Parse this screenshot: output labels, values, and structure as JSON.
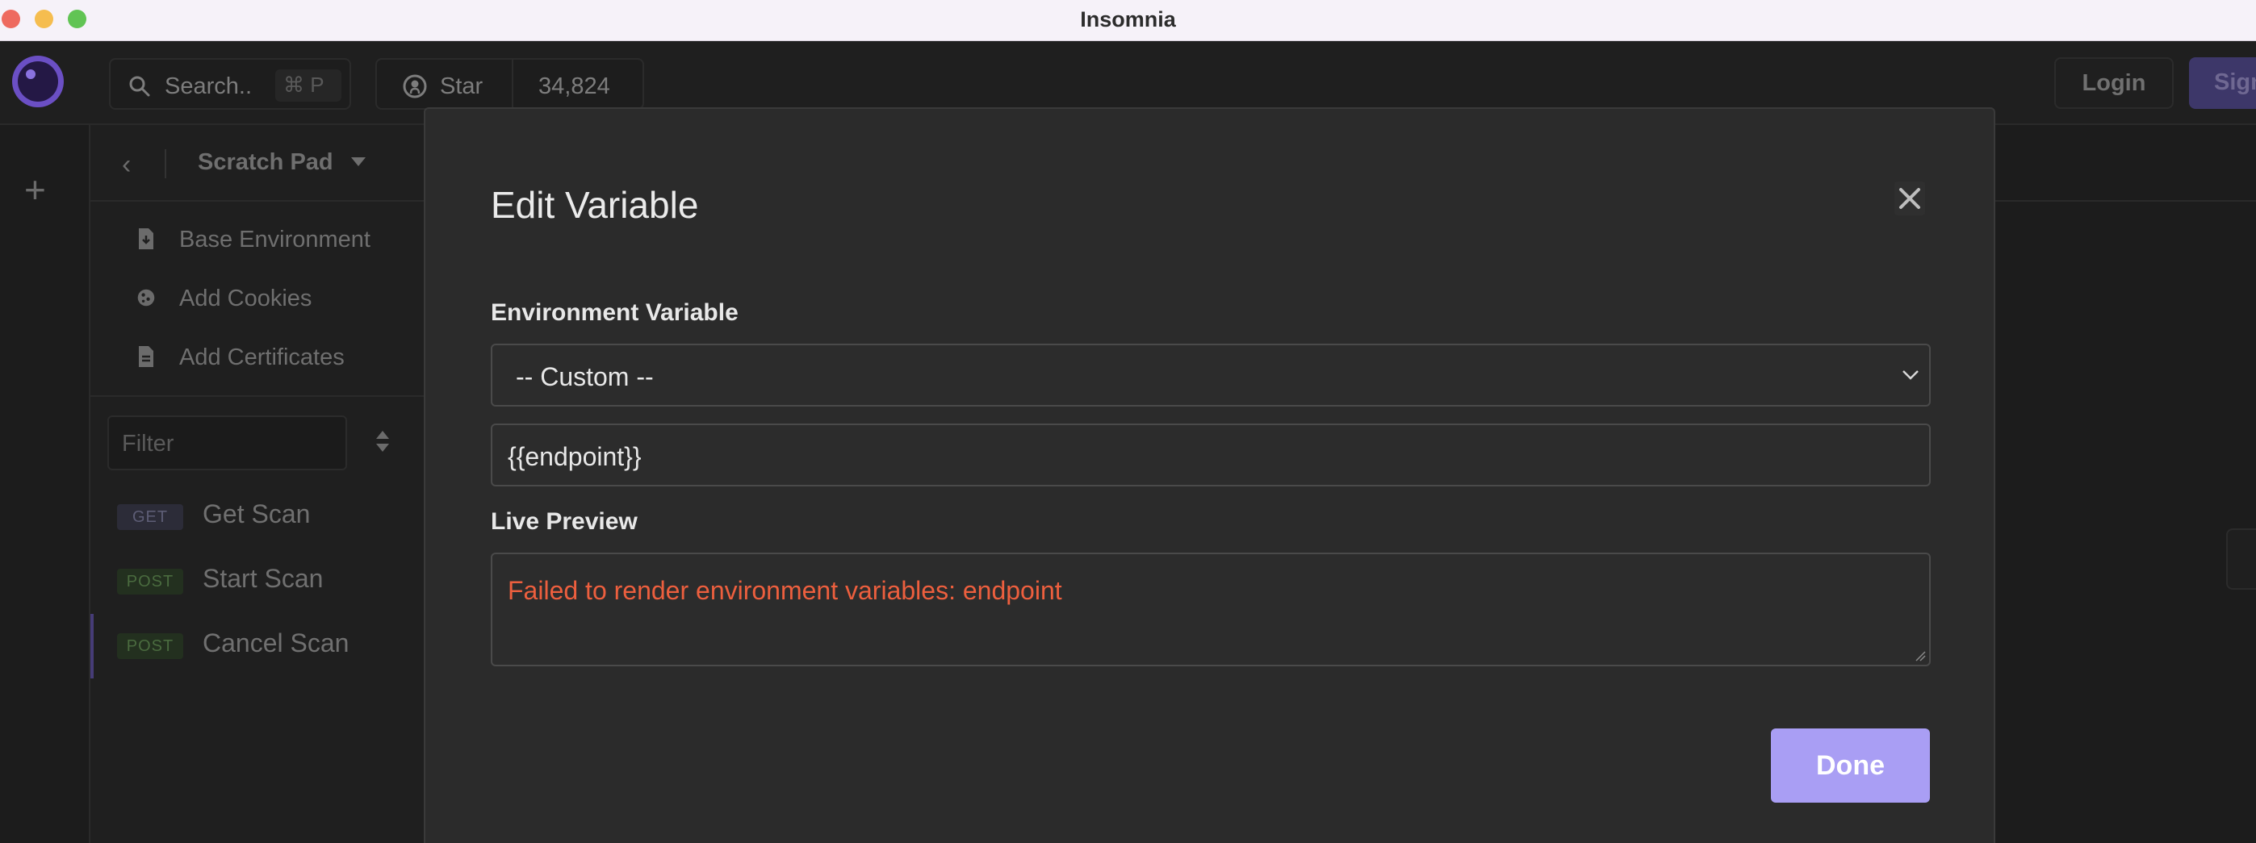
{
  "window": {
    "title": "Insomnia"
  },
  "topbar": {
    "search_placeholder": "Search..",
    "search_shortcut": "⌘ P",
    "star_label": "Star",
    "star_count": "34,824",
    "login_label": "Login",
    "signup_label": "Sign"
  },
  "sidebar": {
    "project_title": "Scratch Pad",
    "items": [
      {
        "label": "Base Environment",
        "icon": "file-download-icon"
      },
      {
        "label": "Add Cookies",
        "icon": "cookie-icon"
      },
      {
        "label": "Add Certificates",
        "icon": "file-certificate-icon"
      }
    ],
    "filter_placeholder": "Filter",
    "requests": [
      {
        "method": "GET",
        "name": "Get Scan"
      },
      {
        "method": "POST",
        "name": "Start Scan"
      },
      {
        "method": "POST",
        "name": "Cancel Scan"
      }
    ]
  },
  "modal": {
    "title": "Edit Variable",
    "env_var_label": "Environment Variable",
    "env_var_selected": "-- Custom --",
    "template_value": "{{endpoint}}",
    "live_preview_label": "Live Preview",
    "live_preview_text": "Failed to render environment variables: endpoint",
    "done_label": "Done"
  },
  "colors": {
    "accent": "#a99ef4",
    "error": "#ed5f3e",
    "modal_bg": "#2b2b2b",
    "app_bg": "#1c1c1c"
  }
}
